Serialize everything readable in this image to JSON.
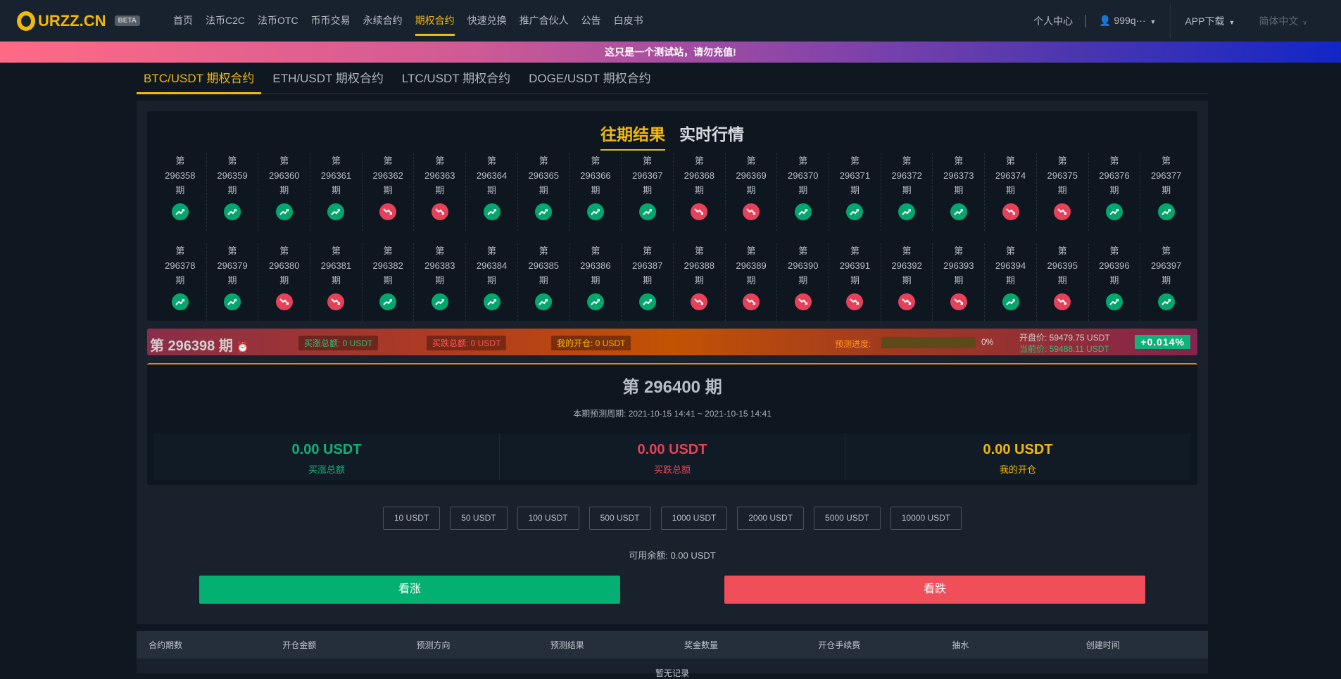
{
  "header": {
    "brand": "URZZ.CN",
    "badge": "BETA",
    "nav": [
      "首页",
      "法币C2C",
      "法币OTC",
      "币币交易",
      "永续合约",
      "期权合约",
      "快速兑换",
      "推广合伙人",
      "公告",
      "白皮书"
    ],
    "active_nav": 5,
    "personal": "个人中心",
    "user": "999q···",
    "app": "APP下载",
    "lang": "简体中文"
  },
  "banner": "这只是一个测试站，请勿充值!",
  "pairs": [
    "BTC/USDT 期权合约",
    "ETH/USDT 期权合约",
    "LTC/USDT 期权合约",
    "DOGE/USDT 期权合约"
  ],
  "results": {
    "tabs": [
      "往期结果",
      "实时行情"
    ],
    "prefix": "第",
    "suffix": "期",
    "periods": [
      {
        "n": "296358",
        "d": "up"
      },
      {
        "n": "296359",
        "d": "up"
      },
      {
        "n": "296360",
        "d": "up"
      },
      {
        "n": "296361",
        "d": "up"
      },
      {
        "n": "296362",
        "d": "down"
      },
      {
        "n": "296363",
        "d": "down"
      },
      {
        "n": "296364",
        "d": "up"
      },
      {
        "n": "296365",
        "d": "up"
      },
      {
        "n": "296366",
        "d": "up"
      },
      {
        "n": "296367",
        "d": "up"
      },
      {
        "n": "296368",
        "d": "down"
      },
      {
        "n": "296369",
        "d": "down"
      },
      {
        "n": "296370",
        "d": "up"
      },
      {
        "n": "296371",
        "d": "up"
      },
      {
        "n": "296372",
        "d": "up"
      },
      {
        "n": "296373",
        "d": "up"
      },
      {
        "n": "296374",
        "d": "down"
      },
      {
        "n": "296375",
        "d": "down"
      },
      {
        "n": "296376",
        "d": "up"
      },
      {
        "n": "296377",
        "d": "up"
      },
      {
        "n": "296378",
        "d": "up"
      },
      {
        "n": "296379",
        "d": "up"
      },
      {
        "n": "296380",
        "d": "down"
      },
      {
        "n": "296381",
        "d": "down"
      },
      {
        "n": "296382",
        "d": "up"
      },
      {
        "n": "296383",
        "d": "up"
      },
      {
        "n": "296384",
        "d": "up"
      },
      {
        "n": "296385",
        "d": "up"
      },
      {
        "n": "296386",
        "d": "up"
      },
      {
        "n": "296387",
        "d": "up"
      },
      {
        "n": "296388",
        "d": "down"
      },
      {
        "n": "296389",
        "d": "down"
      },
      {
        "n": "296390",
        "d": "down"
      },
      {
        "n": "296391",
        "d": "down"
      },
      {
        "n": "296392",
        "d": "down"
      },
      {
        "n": "296393",
        "d": "down"
      },
      {
        "n": "296394",
        "d": "up"
      },
      {
        "n": "296395",
        "d": "down"
      },
      {
        "n": "296396",
        "d": "up"
      },
      {
        "n": "296397",
        "d": "up"
      }
    ]
  },
  "live": {
    "period": "第 296398 期",
    "buy_up": "买涨总额: 0 USDT",
    "buy_down": "买跌总额: 0 USDT",
    "mine": "我的开仓: 0 USDT",
    "progress_label": "预测进度:",
    "progress_pct": 0,
    "progress_text": "0%",
    "open": "开盘价: 59479.75 USDT",
    "current": "当前价: 59488.11 USDT",
    "change": "+0.014%"
  },
  "current": {
    "title": "第 296400 期",
    "period": "本期预测周期: 2021-10-15 14:41 ~ 2021-10-15 14:41",
    "stats": [
      {
        "v": "0.00 USDT",
        "l": "买涨总额",
        "c": "#0fb279"
      },
      {
        "v": "0.00 USDT",
        "l": "买跌总额",
        "c": "#e6415a"
      },
      {
        "v": "0.00 USDT",
        "l": "我的开仓",
        "c": "#f0b90b"
      }
    ]
  },
  "amounts": [
    "10 USDT",
    "50 USDT",
    "100 USDT",
    "500 USDT",
    "1000 USDT",
    "2000 USDT",
    "5000 USDT",
    "10000 USDT"
  ],
  "balance": "可用余额: 0.00 USDT",
  "up_btn": "看涨",
  "down_btn": "看跌",
  "table": {
    "headers": [
      "合约期数",
      "开仓金额",
      "预测方向",
      "预测结果",
      "奖金数量",
      "开仓手续费",
      "抽水",
      "创建时间"
    ],
    "empty": "暂无记录"
  },
  "colors": {
    "up": "#03a66d",
    "down": "#e6415a",
    "accent": "#f0b90b"
  }
}
